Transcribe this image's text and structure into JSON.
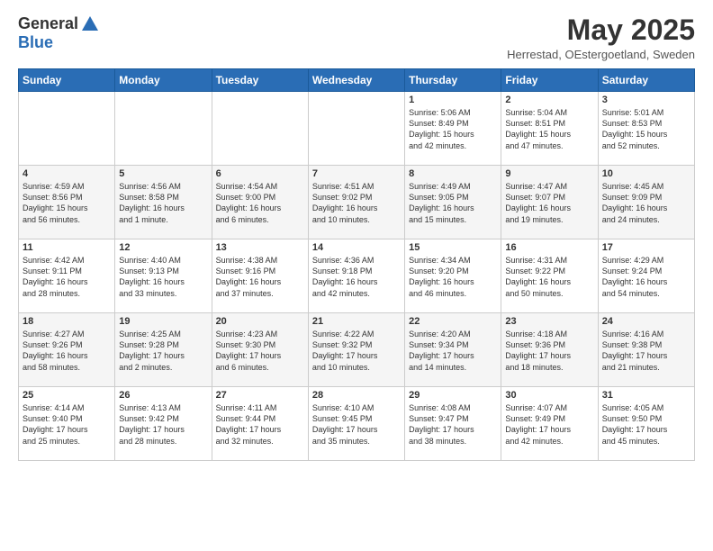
{
  "header": {
    "logo_general": "General",
    "logo_blue": "Blue",
    "month_title": "May 2025",
    "location": "Herrestad, OEstergoetland, Sweden"
  },
  "days_of_week": [
    "Sunday",
    "Monday",
    "Tuesday",
    "Wednesday",
    "Thursday",
    "Friday",
    "Saturday"
  ],
  "weeks": [
    [
      {
        "day": "",
        "info": ""
      },
      {
        "day": "",
        "info": ""
      },
      {
        "day": "",
        "info": ""
      },
      {
        "day": "",
        "info": ""
      },
      {
        "day": "1",
        "info": "Sunrise: 5:06 AM\nSunset: 8:49 PM\nDaylight: 15 hours\nand 42 minutes."
      },
      {
        "day": "2",
        "info": "Sunrise: 5:04 AM\nSunset: 8:51 PM\nDaylight: 15 hours\nand 47 minutes."
      },
      {
        "day": "3",
        "info": "Sunrise: 5:01 AM\nSunset: 8:53 PM\nDaylight: 15 hours\nand 52 minutes."
      }
    ],
    [
      {
        "day": "4",
        "info": "Sunrise: 4:59 AM\nSunset: 8:56 PM\nDaylight: 15 hours\nand 56 minutes."
      },
      {
        "day": "5",
        "info": "Sunrise: 4:56 AM\nSunset: 8:58 PM\nDaylight: 16 hours\nand 1 minute."
      },
      {
        "day": "6",
        "info": "Sunrise: 4:54 AM\nSunset: 9:00 PM\nDaylight: 16 hours\nand 6 minutes."
      },
      {
        "day": "7",
        "info": "Sunrise: 4:51 AM\nSunset: 9:02 PM\nDaylight: 16 hours\nand 10 minutes."
      },
      {
        "day": "8",
        "info": "Sunrise: 4:49 AM\nSunset: 9:05 PM\nDaylight: 16 hours\nand 15 minutes."
      },
      {
        "day": "9",
        "info": "Sunrise: 4:47 AM\nSunset: 9:07 PM\nDaylight: 16 hours\nand 19 minutes."
      },
      {
        "day": "10",
        "info": "Sunrise: 4:45 AM\nSunset: 9:09 PM\nDaylight: 16 hours\nand 24 minutes."
      }
    ],
    [
      {
        "day": "11",
        "info": "Sunrise: 4:42 AM\nSunset: 9:11 PM\nDaylight: 16 hours\nand 28 minutes."
      },
      {
        "day": "12",
        "info": "Sunrise: 4:40 AM\nSunset: 9:13 PM\nDaylight: 16 hours\nand 33 minutes."
      },
      {
        "day": "13",
        "info": "Sunrise: 4:38 AM\nSunset: 9:16 PM\nDaylight: 16 hours\nand 37 minutes."
      },
      {
        "day": "14",
        "info": "Sunrise: 4:36 AM\nSunset: 9:18 PM\nDaylight: 16 hours\nand 42 minutes."
      },
      {
        "day": "15",
        "info": "Sunrise: 4:34 AM\nSunset: 9:20 PM\nDaylight: 16 hours\nand 46 minutes."
      },
      {
        "day": "16",
        "info": "Sunrise: 4:31 AM\nSunset: 9:22 PM\nDaylight: 16 hours\nand 50 minutes."
      },
      {
        "day": "17",
        "info": "Sunrise: 4:29 AM\nSunset: 9:24 PM\nDaylight: 16 hours\nand 54 minutes."
      }
    ],
    [
      {
        "day": "18",
        "info": "Sunrise: 4:27 AM\nSunset: 9:26 PM\nDaylight: 16 hours\nand 58 minutes."
      },
      {
        "day": "19",
        "info": "Sunrise: 4:25 AM\nSunset: 9:28 PM\nDaylight: 17 hours\nand 2 minutes."
      },
      {
        "day": "20",
        "info": "Sunrise: 4:23 AM\nSunset: 9:30 PM\nDaylight: 17 hours\nand 6 minutes."
      },
      {
        "day": "21",
        "info": "Sunrise: 4:22 AM\nSunset: 9:32 PM\nDaylight: 17 hours\nand 10 minutes."
      },
      {
        "day": "22",
        "info": "Sunrise: 4:20 AM\nSunset: 9:34 PM\nDaylight: 17 hours\nand 14 minutes."
      },
      {
        "day": "23",
        "info": "Sunrise: 4:18 AM\nSunset: 9:36 PM\nDaylight: 17 hours\nand 18 minutes."
      },
      {
        "day": "24",
        "info": "Sunrise: 4:16 AM\nSunset: 9:38 PM\nDaylight: 17 hours\nand 21 minutes."
      }
    ],
    [
      {
        "day": "25",
        "info": "Sunrise: 4:14 AM\nSunset: 9:40 PM\nDaylight: 17 hours\nand 25 minutes."
      },
      {
        "day": "26",
        "info": "Sunrise: 4:13 AM\nSunset: 9:42 PM\nDaylight: 17 hours\nand 28 minutes."
      },
      {
        "day": "27",
        "info": "Sunrise: 4:11 AM\nSunset: 9:44 PM\nDaylight: 17 hours\nand 32 minutes."
      },
      {
        "day": "28",
        "info": "Sunrise: 4:10 AM\nSunset: 9:45 PM\nDaylight: 17 hours\nand 35 minutes."
      },
      {
        "day": "29",
        "info": "Sunrise: 4:08 AM\nSunset: 9:47 PM\nDaylight: 17 hours\nand 38 minutes."
      },
      {
        "day": "30",
        "info": "Sunrise: 4:07 AM\nSunset: 9:49 PM\nDaylight: 17 hours\nand 42 minutes."
      },
      {
        "day": "31",
        "info": "Sunrise: 4:05 AM\nSunset: 9:50 PM\nDaylight: 17 hours\nand 45 minutes."
      }
    ]
  ]
}
